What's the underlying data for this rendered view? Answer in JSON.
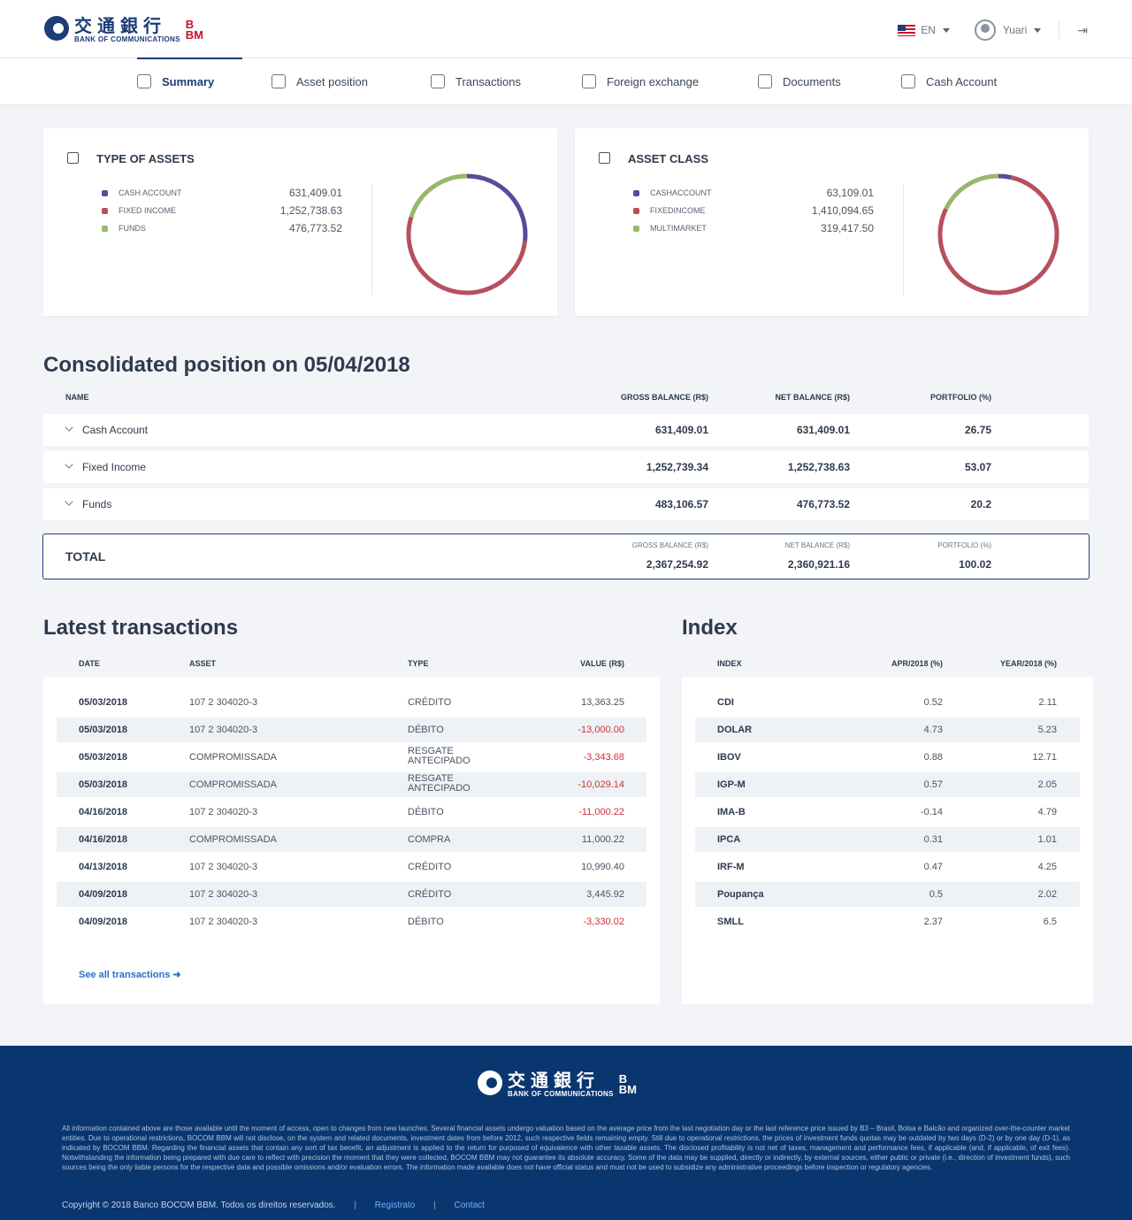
{
  "header": {
    "logo_cn": "交通銀行",
    "logo_en": "BANK OF COMMUNICATIONS",
    "logo_bbm_b": "B",
    "logo_bbm": "BM",
    "lang": "EN",
    "user": "Yuari",
    "logout_icon": "logout-icon"
  },
  "nav": [
    {
      "label": "Summary",
      "icon": "summary-icon"
    },
    {
      "label": "Asset position",
      "icon": "asset-position-icon"
    },
    {
      "label": "Transactions",
      "icon": "transactions-icon"
    },
    {
      "label": "Foreign exchange",
      "icon": "foreign-exchange-icon"
    },
    {
      "label": "Documents",
      "icon": "documents-icon"
    },
    {
      "label": "Cash Account",
      "icon": "cash-account-icon"
    }
  ],
  "type_of_assets": {
    "title": "TYPE OF ASSETS",
    "items": [
      {
        "label": "CASH ACCOUNT",
        "value": "631,409.01",
        "color": "#5a4a9a"
      },
      {
        "label": "FIXED INCOME",
        "value": "1,252,738.63",
        "color": "#b6505d"
      },
      {
        "label": "FUNDS",
        "value": "476,773.52",
        "color": "#95b86a"
      }
    ],
    "shares": [
      26.75,
      53.07,
      20.18
    ]
  },
  "asset_class": {
    "title": "ASSET CLASS",
    "items": [
      {
        "label": "CASHACCOUNT",
        "value": "63,109.01",
        "color": "#5a4a9a"
      },
      {
        "label": "FIXEDINCOME",
        "value": "1,410,094.65",
        "color": "#b6505d"
      },
      {
        "label": "MULTIMARKET",
        "value": "319,417.50",
        "color": "#95b86a"
      }
    ],
    "shares": [
      3.5,
      78.7,
      17.8
    ]
  },
  "consolidated": {
    "title": "Consolidated position on 05/04/2018",
    "headers": {
      "name": "NAME",
      "gross": "GROSS BALANCE (R$)",
      "net": "NET BALANCE (R$)",
      "portfolio": "PORTFOLIO (%)"
    },
    "rows": [
      {
        "name": "Cash Account",
        "gross": "631,409.01",
        "net": "631,409.01",
        "portfolio": "26.75"
      },
      {
        "name": "Fixed Income",
        "gross": "1,252,739.34",
        "net": "1,252,738.63",
        "portfolio": "53.07"
      },
      {
        "name": "Funds",
        "gross": "483,106.57",
        "net": "476,773.52",
        "portfolio": "20.2"
      }
    ],
    "total": {
      "label": "TOTAL",
      "gross_label": "GROSS BALANCE (R$)",
      "net_label": "NET BALANCE (R$)",
      "portfolio_label": "PORTFOLIO (%)",
      "gross": "2,367,254.92",
      "net": "2,360,921.16",
      "portfolio": "100.02"
    }
  },
  "transactions": {
    "title": "Latest transactions",
    "headers": {
      "date": "DATE",
      "asset": "ASSET",
      "type": "TYPE",
      "value": "VALUE (R$)"
    },
    "rows": [
      {
        "date": "05/03/2018",
        "asset": "107 2 304020-3",
        "type": "CRÉDITO",
        "value": "13,363.25"
      },
      {
        "date": "05/03/2018",
        "asset": "107 2 304020-3",
        "type": "DÉBITO",
        "value": "-13,000.00"
      },
      {
        "date": "05/03/2018",
        "asset": "COMPROMISSADA",
        "type": "RESGATE ANTECIPADO",
        "value": "-3,343.68"
      },
      {
        "date": "05/03/2018",
        "asset": "COMPROMISSADA",
        "type": "RESGATE ANTECIPADO",
        "value": "-10,029.14"
      },
      {
        "date": "04/16/2018",
        "asset": "107 2 304020-3",
        "type": "DÉBITO",
        "value": "-11,000.22"
      },
      {
        "date": "04/16/2018",
        "asset": "COMPROMISSADA",
        "type": "COMPRA",
        "value": "11,000.22"
      },
      {
        "date": "04/13/2018",
        "asset": "107 2 304020-3",
        "type": "CRÉDITO",
        "value": "10,990.40"
      },
      {
        "date": "04/09/2018",
        "asset": "107 2 304020-3",
        "type": "CRÉDITO",
        "value": "3,445.92"
      },
      {
        "date": "04/09/2018",
        "asset": "107 2 304020-3",
        "type": "DÉBITO",
        "value": "-3,330.02"
      }
    ],
    "see_all": "See all transactions ➜"
  },
  "index": {
    "title": "Index",
    "headers": {
      "index": "INDEX",
      "apr": "APR/2018 (%)",
      "year": "YEAR/2018 (%)"
    },
    "rows": [
      {
        "index": "CDI",
        "apr": "0.52",
        "year": "2.11"
      },
      {
        "index": "DOLAR",
        "apr": "4.73",
        "year": "5.23"
      },
      {
        "index": "IBOV",
        "apr": "0.88",
        "year": "12.71"
      },
      {
        "index": "IGP-M",
        "apr": "0.57",
        "year": "2.05"
      },
      {
        "index": "IMA-B",
        "apr": "-0.14",
        "year": "4.79"
      },
      {
        "index": "IPCA",
        "apr": "0.31",
        "year": "1.01"
      },
      {
        "index": "IRF-M",
        "apr": "0.47",
        "year": "4.25"
      },
      {
        "index": "Poupança",
        "apr": "0.5",
        "year": "2.02"
      },
      {
        "index": "SMLL",
        "apr": "2.37",
        "year": "6.5"
      }
    ]
  },
  "footer": {
    "disclaimer": "All information contained above are those available until the moment of access, open to changes from new launches. Several financial assets undergo valuation based on the average price from the last negotiation day or the last reference price issued by B3 – Brasil, Bolsa e Balcão and organized over-the-counter market entities. Due to operational restrictions, BOCOM BBM will not disclose, on the system and related documents, investment dates from before 2012, such respective fields remaining empty. Still due to operational restrictions, the prices of investment funds quotas may be outdated by two days (D-2) or by one day (D-1), as indicated by BOCOM BBM. Regarding the financial assets that contain any sort of tax benefit, an adjustment is applied to the return for purposed of equivalence with other taxable assets. The disclosed profitability is not net of taxes, management and performance fees, if applicable (and, if applicable, of exit fees). Notwithstanding the information being prepared with due care to reflect with precision the moment that they were collected, BOCOM BBM may not guarantee its absolute accuracy. Some of the data may be supplied, directly or indirectly, by external sources, either public or private (i.e., direction of investment funds), such sources being the only liable persons for the respective data and possible omissions and/or evaluation errors. The information made available does not have official status and must not be used to subsidize any administrative proceedings before inspection or regulatory agencies.",
    "copyright": "Copyright © 2018 Banco BOCOM BBM. Todos os direitos reservados.",
    "sep": "|",
    "registrato": "Registrato",
    "contact": "Contact"
  }
}
